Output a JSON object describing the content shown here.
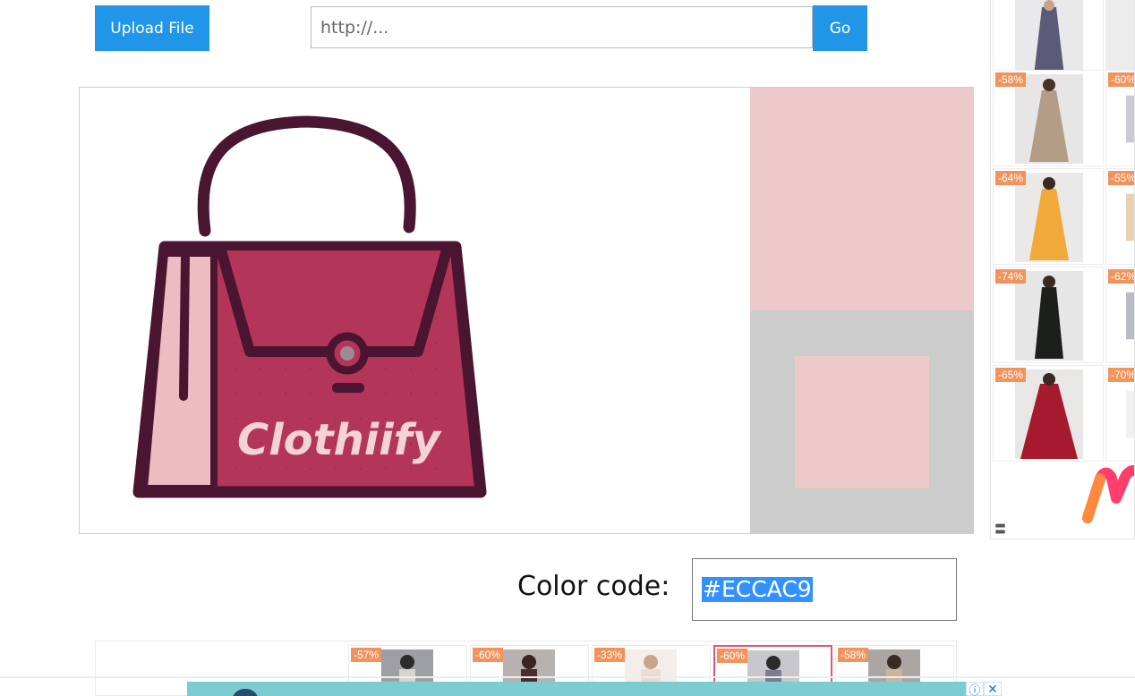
{
  "toolbar": {
    "upload_label": "Upload File",
    "url_placeholder": "http://...",
    "go_label": "Go"
  },
  "image": {
    "logo_text": "Clothiify"
  },
  "picker": {
    "picked_color": "#ECCAC9",
    "preview_bg": "#CCCCCC"
  },
  "color_code": {
    "label": "Color code:",
    "value": "#ECCAC9"
  },
  "side_ad": {
    "discounts": [
      "-58%",
      "-64%",
      "-74%",
      "-65%"
    ],
    "discounts_col2": [
      "-60%",
      "-55%",
      "-62%",
      "-70%"
    ]
  },
  "bottom_ad": {
    "discounts": [
      "-57%",
      "-60%",
      "-33%",
      "-60%",
      "-58%"
    ]
  },
  "colors": {
    "accent": "#2196E8",
    "discount": "#F0935C",
    "selection": "#3390FF"
  }
}
